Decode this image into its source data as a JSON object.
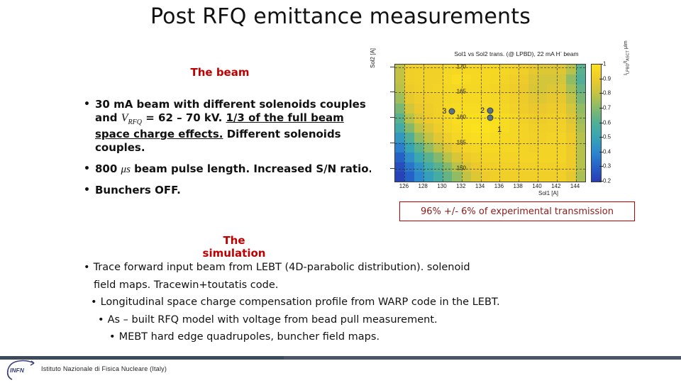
{
  "slide": {
    "title": "Post RFQ emittance measurements"
  },
  "beam_section": {
    "heading": "The beam",
    "bullets": [
      {
        "seg_a": "30 mA beam with different solenoids couples and ",
        "vrfq_main": "V",
        "vrfq_sub": "RFQ",
        "seg_b": " = 62 – 70 kV. ",
        "underlined": "1/3 of the full beam space charge effects.",
        "seg_c": " Different solenoids couples."
      },
      {
        "seg_a": "800 ",
        "mu": "μs",
        "seg_b": " beam pulse length. Increased S/N ratio."
      },
      {
        "seg_a": "Bunchers OFF."
      }
    ]
  },
  "simulation_section": {
    "heading": "The simulation",
    "bullets": [
      "Trace forward input beam from LEBT (4D-parabolic distribution). solenoid",
      "field maps. Tracewin+toutatis code.",
      "Longitudinal space charge compensation profile from WARP code in the LEBT.",
      "As – built RFQ model with voltage from bead pull measurement.",
      "MEBT hard edge quadrupoles, buncher field maps."
    ],
    "bullet_dot": "•"
  },
  "transmission_note": {
    "text": "96% +/- 6% of experimental transmission",
    "border_color": "#C00000",
    "text_color": "#8b1a1a"
  },
  "footer": {
    "logo_text": "INFN",
    "text": "Istituto Nazionale di Fisica Nucleare (Italy)",
    "bar_color": "#4a5568"
  },
  "chart_data": {
    "type": "heatmap",
    "title": "Sol1 vs Sol2 trans. (@ LPBD), 22 mA H",
    "title_sup": "-",
    "title_tail": " beam",
    "xlabel": "Sol1 [A]",
    "ylabel": "Sol2 [A]",
    "colorbar_label_main": "I",
    "colorbar_label_sub1": "LPBD",
    "colorbar_label_mid": "/I",
    "colorbar_label_sub2": "ASCT",
    "colorbar_label_tail": " μIm",
    "xlim": [
      125.0,
      145.0
    ],
    "ylim": [
      147.5,
      170.5
    ],
    "xticks": [
      126,
      128,
      130,
      132,
      134,
      136,
      138,
      140,
      142,
      144
    ],
    "yticks": [
      150,
      155,
      160,
      165,
      170
    ],
    "zlim": [
      0.2,
      1.0
    ],
    "cbticks": [
      0.2,
      0.3,
      0.4,
      0.5,
      0.6,
      0.7,
      0.8,
      0.9,
      1.0
    ],
    "colormap": "viridis-like",
    "grid": true,
    "x_centers": [
      125.5,
      126.5,
      127.5,
      128.5,
      129.5,
      130.5,
      131.5,
      132.5,
      133.5,
      134.5,
      135.5,
      136.5,
      137.5,
      138.5,
      139.5,
      140.5,
      141.5,
      142.5,
      143.5,
      144.5
    ],
    "y_centers": [
      169.5,
      167.5,
      165.5,
      163.5,
      161.5,
      159.5,
      157.5,
      155.5,
      153.5,
      151.5,
      149.5,
      148.0
    ],
    "values": [
      [
        0.8,
        0.92,
        0.93,
        0.93,
        0.93,
        0.95,
        0.96,
        0.96,
        0.96,
        0.96,
        0.96,
        0.95,
        0.94,
        0.92,
        0.88,
        0.86,
        0.86,
        0.86,
        0.78,
        0.62
      ],
      [
        0.8,
        0.92,
        0.93,
        0.93,
        0.93,
        0.96,
        0.98,
        0.97,
        0.96,
        0.96,
        0.95,
        0.94,
        0.92,
        0.9,
        0.86,
        0.84,
        0.84,
        0.84,
        0.72,
        0.6
      ],
      [
        0.78,
        0.9,
        0.92,
        0.93,
        0.94,
        0.95,
        0.95,
        0.95,
        0.95,
        0.95,
        0.94,
        0.93,
        0.91,
        0.89,
        0.85,
        0.84,
        0.86,
        0.86,
        0.76,
        0.64
      ],
      [
        0.74,
        0.88,
        0.91,
        0.92,
        0.93,
        0.95,
        0.96,
        0.96,
        0.96,
        0.96,
        0.95,
        0.94,
        0.92,
        0.9,
        0.87,
        0.86,
        0.88,
        0.88,
        0.8,
        0.68
      ],
      [
        0.68,
        0.84,
        0.89,
        0.91,
        0.93,
        0.96,
        0.97,
        0.97,
        0.97,
        0.97,
        0.96,
        0.95,
        0.93,
        0.91,
        0.89,
        0.89,
        0.9,
        0.9,
        0.84,
        0.72
      ],
      [
        0.62,
        0.78,
        0.86,
        0.9,
        0.93,
        0.96,
        0.98,
        0.99,
        0.99,
        1.0,
        0.99,
        0.97,
        0.95,
        0.93,
        0.91,
        0.91,
        0.92,
        0.92,
        0.86,
        0.74
      ],
      [
        0.55,
        0.7,
        0.8,
        0.86,
        0.91,
        0.95,
        0.97,
        0.99,
        1.0,
        1.0,
        0.99,
        0.97,
        0.95,
        0.94,
        0.92,
        0.92,
        0.93,
        0.93,
        0.88,
        0.76
      ],
      [
        0.46,
        0.6,
        0.72,
        0.8,
        0.87,
        0.92,
        0.95,
        0.97,
        0.98,
        0.98,
        0.97,
        0.96,
        0.95,
        0.94,
        0.93,
        0.93,
        0.94,
        0.94,
        0.9,
        0.78
      ],
      [
        0.38,
        0.5,
        0.62,
        0.72,
        0.8,
        0.86,
        0.91,
        0.94,
        0.95,
        0.96,
        0.96,
        0.95,
        0.95,
        0.94,
        0.93,
        0.94,
        0.94,
        0.94,
        0.9,
        0.78
      ],
      [
        0.3,
        0.42,
        0.52,
        0.62,
        0.7,
        0.78,
        0.85,
        0.9,
        0.92,
        0.94,
        0.94,
        0.94,
        0.94,
        0.94,
        0.94,
        0.94,
        0.94,
        0.94,
        0.9,
        0.78
      ],
      [
        0.25,
        0.35,
        0.44,
        0.54,
        0.62,
        0.7,
        0.78,
        0.85,
        0.89,
        0.92,
        0.93,
        0.93,
        0.93,
        0.93,
        0.93,
        0.93,
        0.93,
        0.93,
        0.9,
        0.78
      ],
      [
        0.22,
        0.3,
        0.4,
        0.48,
        0.56,
        0.64,
        0.72,
        0.8,
        0.86,
        0.9,
        0.92,
        0.92,
        0.92,
        0.92,
        0.92,
        0.92,
        0.92,
        0.92,
        0.88,
        0.76
      ]
    ],
    "markers": [
      {
        "label": "3",
        "x": 131.0,
        "y": 161.3
      },
      {
        "label": "2",
        "x": 135.0,
        "y": 161.4
      },
      {
        "label": "1",
        "x": 135.0,
        "y": 160.0
      }
    ],
    "marker_label_offsets": [
      {
        "label": "3",
        "dx": -11,
        "dy": 0
      },
      {
        "label": "2",
        "dx": -11,
        "dy": 0
      },
      {
        "label": "1",
        "dx": 13,
        "dy": 17
      }
    ]
  }
}
